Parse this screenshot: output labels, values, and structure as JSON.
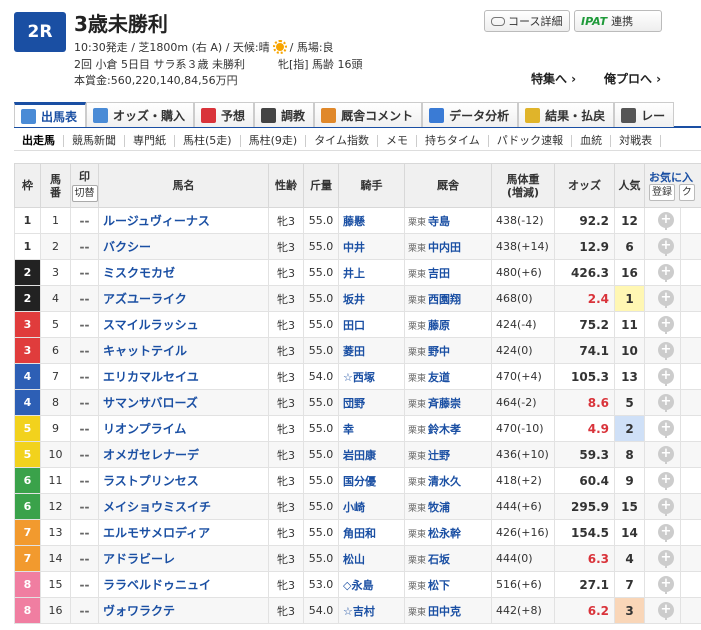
{
  "race": {
    "number": "2R",
    "title": "3歳未勝利",
    "info1_a": "10:30発走 / 芝1800m (右 A) / 天候:晴",
    "info1_b": "/ 馬場:良",
    "info2": "2回 小倉 5日目 サラ系３歳 未勝利　　　牝[指] 馬齢 16頭",
    "info3": "本賞金:560,220,140,84,56万円"
  },
  "header_buttons": {
    "course": "コース詳細",
    "ipat_logo": "IPAT",
    "ipat": "連携"
  },
  "header_links": {
    "tokushu": "特集へ ›",
    "orepuro": "俺プロへ ›"
  },
  "main_tabs": [
    {
      "label": "出馬表",
      "icon": "table-icon",
      "color": "#4a8bd6"
    },
    {
      "label": "オッズ・購入",
      "icon": "odds-icon",
      "color": "#4a8bd6"
    },
    {
      "label": "予想",
      "icon": "target-icon",
      "color": "#d9333a"
    },
    {
      "label": "調教",
      "icon": "stopwatch-icon",
      "color": "#444444"
    },
    {
      "label": "厩舎コメント",
      "icon": "trainer-icon",
      "color": "#e0882a"
    },
    {
      "label": "データ分析",
      "icon": "bar-chart-icon",
      "color": "#3a7bd5"
    },
    {
      "label": "結果・払戻",
      "icon": "coins-icon",
      "color": "#e0b42a"
    },
    {
      "label": "レー",
      "icon": "video-icon",
      "color": "#555555"
    }
  ],
  "sub_tabs": [
    "出走馬",
    "競馬新聞",
    "専門紙",
    "馬柱(5走)",
    "馬柱(9走)",
    "タイム指数",
    "メモ",
    "持ちタイム",
    "パドック速報",
    "血統",
    "対戦表"
  ],
  "table_headers": {
    "waku": "枠",
    "umaban": "馬番",
    "mark": "印",
    "kiri": "切替",
    "name": "馬名",
    "sexage": "性齢",
    "kinryo": "斤量",
    "jockey": "騎手",
    "trainer": "厩舎",
    "weight": "馬体重",
    "weight_sub": "(増減)",
    "odds": "オッズ",
    "pop": "人気",
    "fav": "お気に入",
    "reg": "登録",
    "extra": "ク"
  },
  "waku_colors": {
    "1": {
      "bg": "#ffffff",
      "fg": "#333333"
    },
    "2": {
      "bg": "#222222",
      "fg": "#ffffff"
    },
    "3": {
      "bg": "#e03c3c",
      "fg": "#ffffff"
    },
    "4": {
      "bg": "#2d5fb5",
      "fg": "#ffffff"
    },
    "5": {
      "bg": "#f2d21d",
      "fg": "#ffffff"
    },
    "6": {
      "bg": "#3aa24a",
      "fg": "#ffffff"
    },
    "7": {
      "bg": "#f29a2e",
      "fg": "#ffffff"
    },
    "8": {
      "bg": "#f07ea1",
      "fg": "#ffffff"
    }
  },
  "horses": [
    {
      "waku": "1",
      "umaban": "1",
      "mark": "--",
      "name": "ルージュヴィーナス",
      "sexage": "牝3",
      "kinryo": "55.0",
      "jockey": "藤懸",
      "region": "栗東",
      "trainer": "寺島",
      "weight": "438(-12)",
      "odds": "92.2",
      "odds_red": false,
      "pop": "12"
    },
    {
      "waku": "1",
      "umaban": "2",
      "mark": "--",
      "name": "バクシー",
      "sexage": "牝3",
      "kinryo": "55.0",
      "jockey": "中井",
      "region": "栗東",
      "trainer": "中内田",
      "weight": "438(+14)",
      "odds": "12.9",
      "odds_red": false,
      "pop": "6"
    },
    {
      "waku": "2",
      "umaban": "3",
      "mark": "--",
      "name": "ミスクモカゼ",
      "sexage": "牝3",
      "kinryo": "55.0",
      "jockey": "井上",
      "region": "栗東",
      "trainer": "吉田",
      "weight": "480(+6)",
      "odds": "426.3",
      "odds_red": false,
      "pop": "16"
    },
    {
      "waku": "2",
      "umaban": "4",
      "mark": "--",
      "name": "アズユーライク",
      "sexage": "牝3",
      "kinryo": "55.0",
      "jockey": "坂井",
      "region": "栗東",
      "trainer": "西園翔",
      "weight": "468(0)",
      "odds": "2.4",
      "odds_red": true,
      "pop": "1"
    },
    {
      "waku": "3",
      "umaban": "5",
      "mark": "--",
      "name": "スマイルラッシュ",
      "sexage": "牝3",
      "kinryo": "55.0",
      "jockey": "田口",
      "region": "栗東",
      "trainer": "藤原",
      "weight": "424(-4)",
      "odds": "75.2",
      "odds_red": false,
      "pop": "11"
    },
    {
      "waku": "3",
      "umaban": "6",
      "mark": "--",
      "name": "キャットテイル",
      "sexage": "牝3",
      "kinryo": "55.0",
      "jockey": "菱田",
      "region": "栗東",
      "trainer": "野中",
      "weight": "424(0)",
      "odds": "74.1",
      "odds_red": false,
      "pop": "10"
    },
    {
      "waku": "4",
      "umaban": "7",
      "mark": "--",
      "name": "エリカマルセイユ",
      "sexage": "牝3",
      "kinryo": "54.0",
      "jockey": "☆西塚",
      "region": "栗東",
      "trainer": "友道",
      "weight": "470(+4)",
      "odds": "105.3",
      "odds_red": false,
      "pop": "13"
    },
    {
      "waku": "4",
      "umaban": "8",
      "mark": "--",
      "name": "サマンサバローズ",
      "sexage": "牝3",
      "kinryo": "55.0",
      "jockey": "団野",
      "region": "栗東",
      "trainer": "斉藤崇",
      "weight": "464(-2)",
      "odds": "8.6",
      "odds_red": true,
      "pop": "5"
    },
    {
      "waku": "5",
      "umaban": "9",
      "mark": "--",
      "name": "リオンプライム",
      "sexage": "牝3",
      "kinryo": "55.0",
      "jockey": "幸",
      "region": "栗東",
      "trainer": "鈴木孝",
      "weight": "470(-10)",
      "odds": "4.9",
      "odds_red": true,
      "pop": "2"
    },
    {
      "waku": "5",
      "umaban": "10",
      "mark": "--",
      "name": "オメガセレナーデ",
      "sexage": "牝3",
      "kinryo": "55.0",
      "jockey": "岩田康",
      "region": "栗東",
      "trainer": "辻野",
      "weight": "436(+10)",
      "odds": "59.3",
      "odds_red": false,
      "pop": "8"
    },
    {
      "waku": "6",
      "umaban": "11",
      "mark": "--",
      "name": "ラストプリンセス",
      "sexage": "牝3",
      "kinryo": "55.0",
      "jockey": "国分優",
      "region": "栗東",
      "trainer": "清水久",
      "weight": "418(+2)",
      "odds": "60.4",
      "odds_red": false,
      "pop": "9"
    },
    {
      "waku": "6",
      "umaban": "12",
      "mark": "--",
      "name": "メイショウミスイチ",
      "sexage": "牝3",
      "kinryo": "55.0",
      "jockey": "小崎",
      "region": "栗東",
      "trainer": "牧浦",
      "weight": "444(+6)",
      "odds": "295.9",
      "odds_red": false,
      "pop": "15"
    },
    {
      "waku": "7",
      "umaban": "13",
      "mark": "--",
      "name": "エルモサメロディア",
      "sexage": "牝3",
      "kinryo": "55.0",
      "jockey": "角田和",
      "region": "栗東",
      "trainer": "松永幹",
      "weight": "426(+16)",
      "odds": "154.5",
      "odds_red": false,
      "pop": "14"
    },
    {
      "waku": "7",
      "umaban": "14",
      "mark": "--",
      "name": "アドラビーレ",
      "sexage": "牝3",
      "kinryo": "55.0",
      "jockey": "松山",
      "region": "栗東",
      "trainer": "石坂",
      "weight": "444(0)",
      "odds": "6.3",
      "odds_red": true,
      "pop": "4"
    },
    {
      "waku": "8",
      "umaban": "15",
      "mark": "--",
      "name": "ララベルドゥニュイ",
      "sexage": "牝3",
      "kinryo": "53.0",
      "jockey": "◇永島",
      "region": "栗東",
      "trainer": "松下",
      "weight": "516(+6)",
      "odds": "27.1",
      "odds_red": false,
      "pop": "7"
    },
    {
      "waku": "8",
      "umaban": "16",
      "mark": "--",
      "name": "ヴォワラクテ",
      "sexage": "牝3",
      "kinryo": "54.0",
      "jockey": "☆吉村",
      "region": "栗東",
      "trainer": "田中克",
      "weight": "442(+8)",
      "odds": "6.2",
      "odds_red": true,
      "pop": "3"
    }
  ]
}
